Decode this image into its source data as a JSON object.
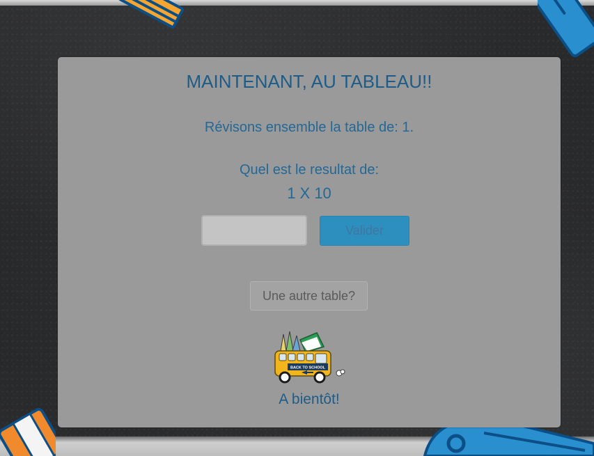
{
  "title": "MAINTENANT, AU TABLEAU!!",
  "subtitle": "Révisons ensemble la table de: 1.",
  "question": {
    "label": "Quel est le resultat de:",
    "operation": "1 X 10"
  },
  "answer_input": {
    "value": "",
    "placeholder": ""
  },
  "buttons": {
    "validate": "Valider",
    "other_table": "Une autre table?"
  },
  "bus_sign": "BACK TO SCHOOL",
  "farewell": "A bientôt!",
  "colors": {
    "accent_text": "#1e5c87",
    "button_blue": "#2d8fbd",
    "panel_gray": "#9a9a9a",
    "chalkboard": "#262729"
  },
  "icons": [
    "pencil-icon",
    "ruler-icon",
    "school-bus-icon",
    "crayon-icon",
    "stapler-icon"
  ]
}
